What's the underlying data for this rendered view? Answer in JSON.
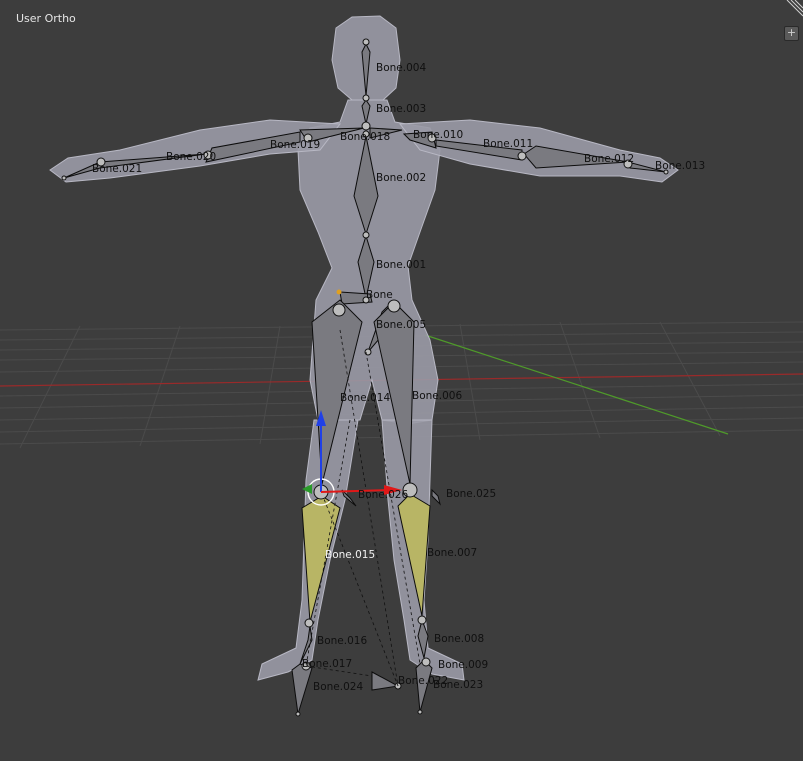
{
  "viewport": {
    "title": "User Ortho",
    "add_button_glyph": "+",
    "background_color": "#3d3d3d",
    "grid_color": "#4a4a4a",
    "x_axis_color": "#9a2a2a",
    "y_axis_color": "#4f9a2a"
  },
  "mesh": {
    "fill_color": "#9a9aa6",
    "edge_color": "#b8b8c4"
  },
  "armature": {
    "bone_color": "#7a7a80",
    "selected_bone_color": "#b8b565",
    "active_bone_label": "Bone.015",
    "labels": {
      "bone_004": "Bone.004",
      "bone_003": "Bone.003",
      "bone_018": "Bone.018",
      "bone_010": "Bone.010",
      "bone_019": "Bone.019",
      "bone_011": "Bone.011",
      "bone_020": "Bone.020",
      "bone_012": "Bone.012",
      "bone_021": "Bone.021",
      "bone_013": "Bone.013",
      "bone_002": "Bone.002",
      "bone_001": "Bone.001",
      "bone": "Bone",
      "bone_005": "Bone.005",
      "bone_014": "Bone.014",
      "bone_006": "Bone.006",
      "bone_026": "Bone.026",
      "bone_025": "Bone.025",
      "bone_015": "Bone.015",
      "bone_007": "Bone.007",
      "bone_016": "Bone.016",
      "bone_008": "Bone.008",
      "bone_017": "Bone.017",
      "bone_009": "Bone.009",
      "bone_024": "Bone.024",
      "bone_022": "Bone.022",
      "bone_023": "Bone.023"
    }
  },
  "gizmo": {
    "x_color": "#e01818",
    "y_color": "#2a9a2a",
    "z_color": "#2040e8"
  }
}
